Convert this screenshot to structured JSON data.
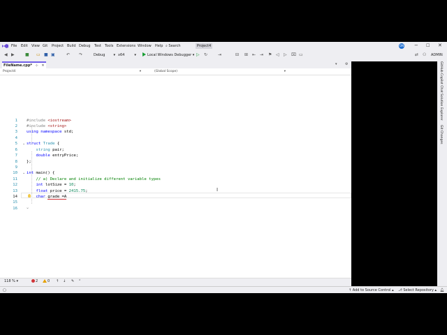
{
  "menu": {
    "items": [
      "File",
      "Edit",
      "View",
      "Git",
      "Project",
      "Build",
      "Debug",
      "Test",
      "Tools",
      "Extensions",
      "Window",
      "Help"
    ],
    "search_label": "Search",
    "project_name": "Project4",
    "avatar_initials": "ON",
    "admin_label": "ADMIN"
  },
  "toolbar": {
    "config": "Debug",
    "platform": "x64",
    "run_label": "Local Windows Debugger"
  },
  "tabs": [
    {
      "label": "FileName.cpp*",
      "active": true
    }
  ],
  "navbar": {
    "project": "Project4",
    "scope": "(Global Scope)"
  },
  "editor": {
    "current_line": 14,
    "lines": [
      {
        "n": "1"
      },
      {
        "n": "2"
      },
      {
        "n": "3"
      },
      {
        "n": "4"
      },
      {
        "n": "5"
      },
      {
        "n": "6"
      },
      {
        "n": "7"
      },
      {
        "n": "8"
      },
      {
        "n": "9"
      },
      {
        "n": "10"
      },
      {
        "n": "11"
      },
      {
        "n": "12"
      },
      {
        "n": "13"
      },
      {
        "n": "14"
      },
      {
        "n": "15"
      },
      {
        "n": "16"
      }
    ],
    "code": {
      "l1": {
        "kw": "#include",
        "str": "<iostream>"
      },
      "l2": {
        "kw": "#include",
        "str": "<string>"
      },
      "l3": {
        "kw1": "using",
        "kw2": "namespace",
        "rest": "std;"
      },
      "l5": {
        "kw": "struct",
        "type": "Trade",
        "rest": "{"
      },
      "l6": {
        "type": "string",
        "rest": "pair;"
      },
      "l7": {
        "kw": "double",
        "rest": "entryPrice;"
      },
      "l8": {
        "rest": "};"
      },
      "l10": {
        "kw": "int",
        "rest": "main() {"
      },
      "l11": {
        "comment": "// a) Declare and initialize different variable types"
      },
      "l12": {
        "kw": "int",
        "rest": "lotSize =",
        "num": "10",
        "end": ";"
      },
      "l13": {
        "kw": "float",
        "rest": "price =",
        "num": "2415.75",
        "end": ";"
      },
      "l14": {
        "kw": "char",
        "rest": "grade =A"
      }
    }
  },
  "editor_status": {
    "zoom": "118 %",
    "errors": "2",
    "warnings": "0"
  },
  "statusbar": {
    "add_source": "Add to Source Control",
    "select_repo": "Select Repository"
  },
  "sidetabs": [
    "GitHub Copilot Chat",
    "Solution Explorer",
    "Git Changes"
  ],
  "colors": {
    "accent": "#7160e8",
    "keyword": "#0000ff",
    "type": "#2b91af",
    "string": "#a31515",
    "comment": "#008000",
    "number": "#098658"
  }
}
